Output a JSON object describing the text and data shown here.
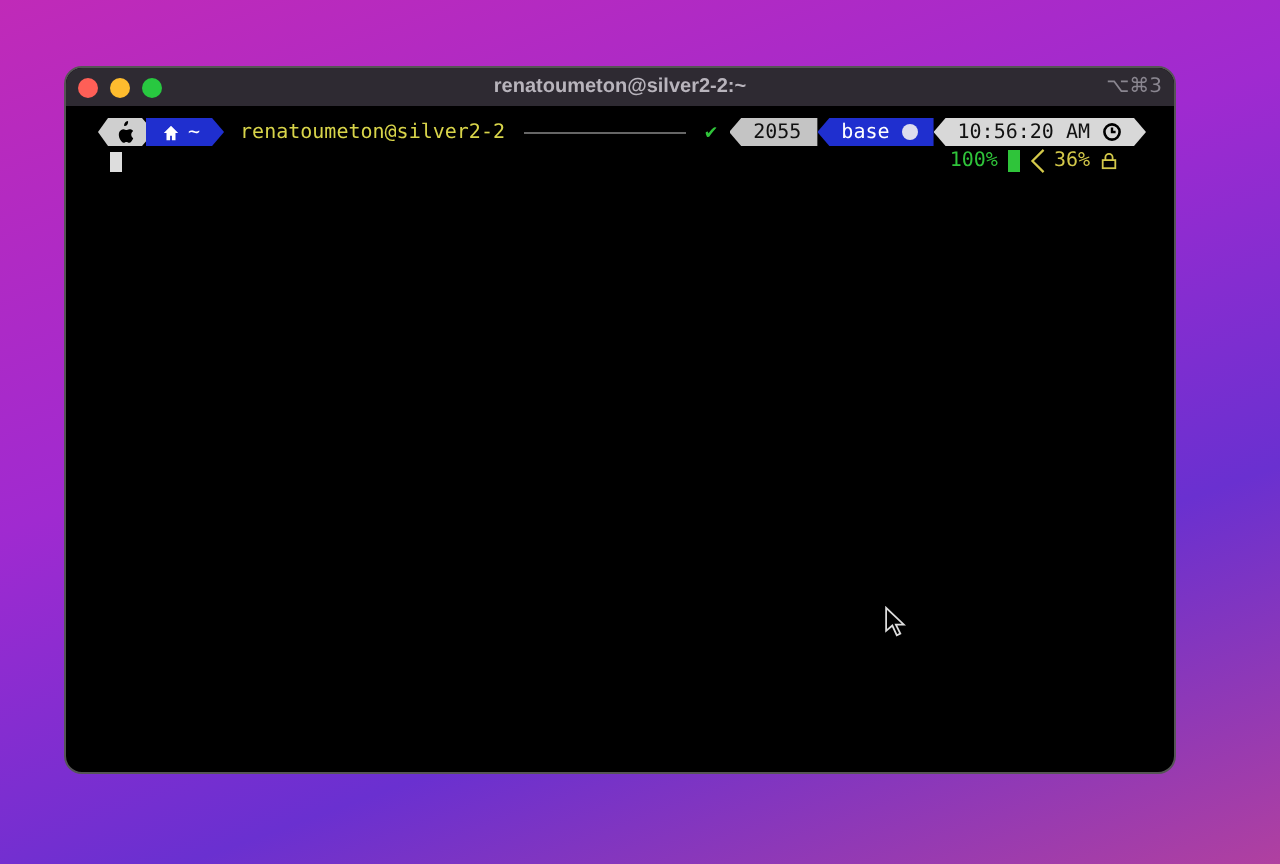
{
  "window": {
    "title": "renatoumeton@silver2-2:~",
    "shortcut": "⌥⌘3"
  },
  "prompt": {
    "home_text": "~",
    "user_host": "renatoumeton@silver2-2",
    "status": "✔",
    "right_segments": [
      {
        "kind": "count",
        "text": "2055"
      },
      {
        "kind": "env",
        "text": "base"
      },
      {
        "kind": "time",
        "text": "10:56:20 AM"
      }
    ]
  },
  "status_line": [
    {
      "kind": "battery",
      "text": "100%"
    },
    {
      "kind": "disk",
      "text": "36%"
    }
  ]
}
